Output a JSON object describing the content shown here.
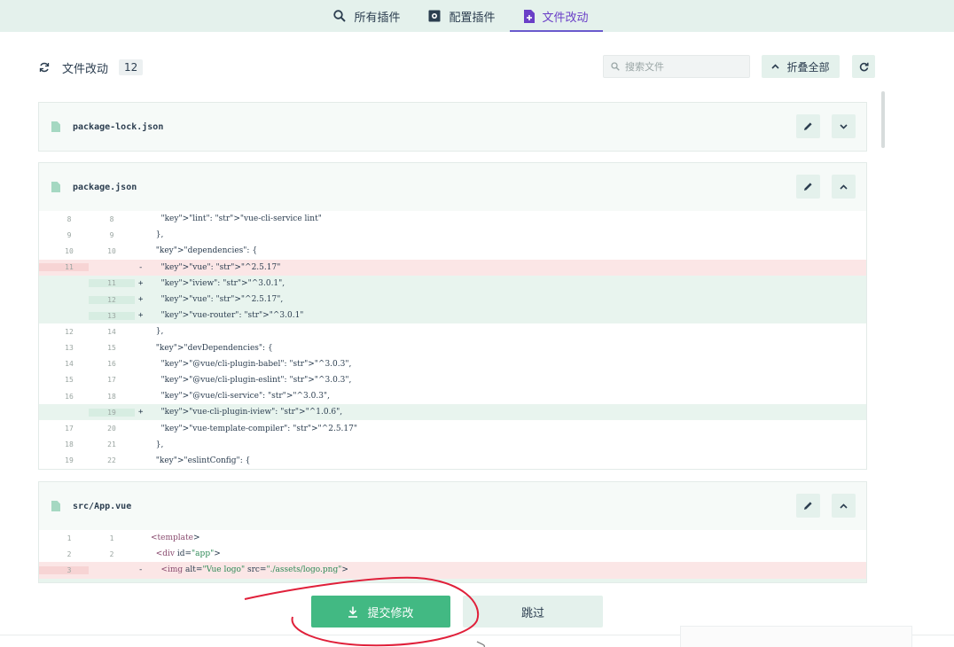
{
  "nav": {
    "tabs": [
      {
        "label": "所有插件",
        "icon": "search-icon"
      },
      {
        "label": "配置插件",
        "icon": "puzzle-icon"
      },
      {
        "label": "文件改动",
        "icon": "file-plus-icon",
        "active": true
      }
    ]
  },
  "header": {
    "title": "文件改动",
    "count": "12",
    "search_placeholder": "搜索文件",
    "collapse_label": "折叠全部"
  },
  "files": [
    {
      "name": "package-lock.json",
      "expanded": false,
      "rows": []
    },
    {
      "name": "package.json",
      "expanded": true,
      "rows": [
        {
          "old": "8",
          "new": "8",
          "sign": "",
          "type": "ctx",
          "code": "    \"lint\": \"vue-cli-service lint\""
        },
        {
          "old": "9",
          "new": "9",
          "sign": "",
          "type": "ctx",
          "code": "  },"
        },
        {
          "old": "10",
          "new": "10",
          "sign": "",
          "type": "ctx",
          "code": "  \"dependencies\": {"
        },
        {
          "old": "11",
          "new": "",
          "sign": "-",
          "type": "del",
          "code": "    \"vue\": \"^2.5.17\""
        },
        {
          "old": "",
          "new": "11",
          "sign": "+",
          "type": "add",
          "code": "    \"iview\": \"^3.0.1\","
        },
        {
          "old": "",
          "new": "12",
          "sign": "+",
          "type": "add",
          "code": "    \"vue\": \"^2.5.17\","
        },
        {
          "old": "",
          "new": "13",
          "sign": "+",
          "type": "add",
          "code": "    \"vue-router\": \"^3.0.1\""
        },
        {
          "old": "12",
          "new": "14",
          "sign": "",
          "type": "ctx",
          "code": "  },"
        },
        {
          "old": "13",
          "new": "15",
          "sign": "",
          "type": "ctx",
          "code": "  \"devDependencies\": {"
        },
        {
          "old": "14",
          "new": "16",
          "sign": "",
          "type": "ctx",
          "code": "    \"@vue/cli-plugin-babel\": \"^3.0.3\","
        },
        {
          "old": "15",
          "new": "17",
          "sign": "",
          "type": "ctx",
          "code": "    \"@vue/cli-plugin-eslint\": \"^3.0.3\","
        },
        {
          "old": "16",
          "new": "18",
          "sign": "",
          "type": "ctx",
          "code": "    \"@vue/cli-service\": \"^3.0.3\","
        },
        {
          "old": "",
          "new": "19",
          "sign": "+",
          "type": "add",
          "code": "    \"vue-cli-plugin-iview\": \"^1.0.6\","
        },
        {
          "old": "17",
          "new": "20",
          "sign": "",
          "type": "ctx",
          "code": "    \"vue-template-compiler\": \"^2.5.17\""
        },
        {
          "old": "18",
          "new": "21",
          "sign": "",
          "type": "ctx",
          "code": "  },"
        },
        {
          "old": "19",
          "new": "22",
          "sign": "",
          "type": "ctx",
          "code": "  \"eslintConfig\": {"
        }
      ]
    },
    {
      "name": "src/App.vue",
      "expanded": true,
      "rows": [
        {
          "old": "1",
          "new": "1",
          "sign": "",
          "type": "ctx",
          "code": "<template>"
        },
        {
          "old": "2",
          "new": "2",
          "sign": "",
          "type": "ctx",
          "code": "  <div id=\"app\">"
        },
        {
          "old": "3",
          "new": "",
          "sign": "-",
          "type": "del",
          "code": "    <img alt=\"Vue logo\" src=\"./assets/logo.png\">"
        },
        {
          "old": "",
          "new": "",
          "sign": "",
          "type": "add",
          "code": ""
        }
      ]
    }
  ],
  "actions": {
    "submit_label": "提交修改",
    "skip_label": "跳过"
  },
  "colors": {
    "accent": "#42b983",
    "tab_active": "#6a3fc7",
    "added_bg": "#e8f4ee",
    "removed_bg": "#fbe6e6",
    "annotation": "#e0203a"
  }
}
